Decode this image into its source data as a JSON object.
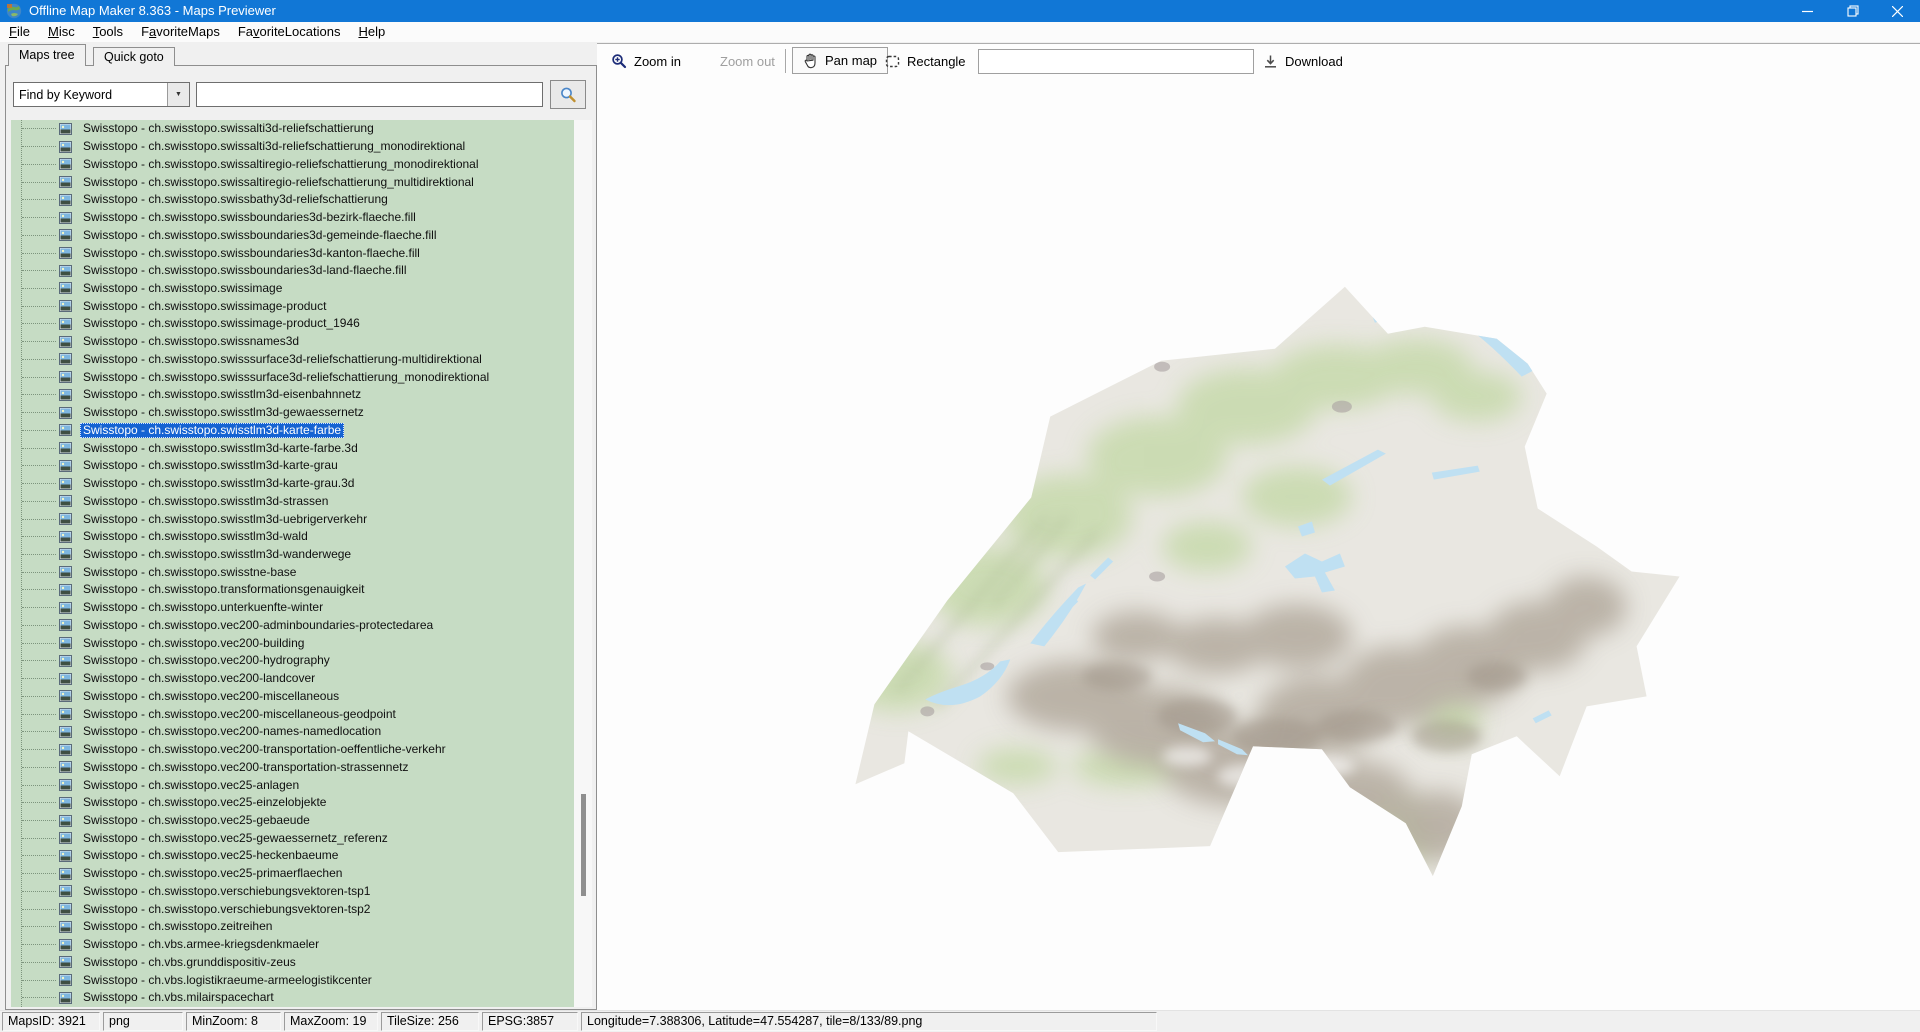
{
  "window": {
    "title": "Offline Map Maker 8.363 - Maps Previewer",
    "controls": [
      "minimize-icon",
      "restore-icon",
      "close-icon"
    ]
  },
  "menubar": {
    "items": [
      {
        "label": "File",
        "accel": 0
      },
      {
        "label": "Misc",
        "accel": 0
      },
      {
        "label": "Tools",
        "accel": 0
      },
      {
        "label": "FavoriteMaps",
        "accel": 1
      },
      {
        "label": "FavoriteLocations",
        "accel": 2
      },
      {
        "label": "Help",
        "accel": 0
      }
    ]
  },
  "tabs": [
    {
      "label": "Maps tree",
      "active": true
    },
    {
      "label": "Quick goto",
      "active": false
    }
  ],
  "search": {
    "mode": "Find by Keyword",
    "query": "",
    "button_icon": "search-icon"
  },
  "maps_tree": {
    "selected_index": 17,
    "items": [
      "Swisstopo - ch.swisstopo.swissalti3d-reliefschattierung",
      "Swisstopo - ch.swisstopo.swissalti3d-reliefschattierung_monodirektional",
      "Swisstopo - ch.swisstopo.swissaltiregio-reliefschattierung_monodirektional",
      "Swisstopo - ch.swisstopo.swissaltiregio-reliefschattierung_multidirektional",
      "Swisstopo - ch.swisstopo.swissbathy3d-reliefschattierung",
      "Swisstopo - ch.swisstopo.swissboundaries3d-bezirk-flaeche.fill",
      "Swisstopo - ch.swisstopo.swissboundaries3d-gemeinde-flaeche.fill",
      "Swisstopo - ch.swisstopo.swissboundaries3d-kanton-flaeche.fill",
      "Swisstopo - ch.swisstopo.swissboundaries3d-land-flaeche.fill",
      "Swisstopo - ch.swisstopo.swissimage",
      "Swisstopo - ch.swisstopo.swissimage-product",
      "Swisstopo - ch.swisstopo.swissimage-product_1946",
      "Swisstopo - ch.swisstopo.swissnames3d",
      "Swisstopo - ch.swisstopo.swisssurface3d-reliefschattierung-multidirektional",
      "Swisstopo - ch.swisstopo.swisssurface3d-reliefschattierung_monodirektional",
      "Swisstopo - ch.swisstopo.swisstlm3d-eisenbahnnetz",
      "Swisstopo - ch.swisstopo.swisstlm3d-gewaessernetz",
      "Swisstopo - ch.swisstopo.swisstlm3d-karte-farbe",
      "Swisstopo - ch.swisstopo.swisstlm3d-karte-farbe.3d",
      "Swisstopo - ch.swisstopo.swisstlm3d-karte-grau",
      "Swisstopo - ch.swisstopo.swisstlm3d-karte-grau.3d",
      "Swisstopo - ch.swisstopo.swisstlm3d-strassen",
      "Swisstopo - ch.swisstopo.swisstlm3d-uebrigerverkehr",
      "Swisstopo - ch.swisstopo.swisstlm3d-wald",
      "Swisstopo - ch.swisstopo.swisstlm3d-wanderwege",
      "Swisstopo - ch.swisstopo.swisstne-base",
      "Swisstopo - ch.swisstopo.transformationsgenauigkeit",
      "Swisstopo - ch.swisstopo.unterkuenfte-winter",
      "Swisstopo - ch.swisstopo.vec200-adminboundaries-protectedarea",
      "Swisstopo - ch.swisstopo.vec200-building",
      "Swisstopo - ch.swisstopo.vec200-hydrography",
      "Swisstopo - ch.swisstopo.vec200-landcover",
      "Swisstopo - ch.swisstopo.vec200-miscellaneous",
      "Swisstopo - ch.swisstopo.vec200-miscellaneous-geodpoint",
      "Swisstopo - ch.swisstopo.vec200-names-namedlocation",
      "Swisstopo - ch.swisstopo.vec200-transportation-oeffentliche-verkehr",
      "Swisstopo - ch.swisstopo.vec200-transportation-strassennetz",
      "Swisstopo - ch.swisstopo.vec25-anlagen",
      "Swisstopo - ch.swisstopo.vec25-einzelobjekte",
      "Swisstopo - ch.swisstopo.vec25-gebaeude",
      "Swisstopo - ch.swisstopo.vec25-gewaessernetz_referenz",
      "Swisstopo - ch.swisstopo.vec25-heckenbaeume",
      "Swisstopo - ch.swisstopo.vec25-primaerflaechen",
      "Swisstopo - ch.swisstopo.verschiebungsvektoren-tsp1",
      "Swisstopo - ch.swisstopo.verschiebungsvektoren-tsp2",
      "Swisstopo - ch.swisstopo.zeitreihen",
      "Swisstopo - ch.vbs.armee-kriegsdenkmaeler",
      "Swisstopo - ch.vbs.grunddispositiv-zeus",
      "Swisstopo - ch.vbs.logistikraeume-armeelogistikcenter",
      "Swisstopo - ch.vbs.milairspacechart"
    ]
  },
  "toolbar": {
    "zoom_in": "Zoom in",
    "zoom_out": "Zoom out",
    "pan_map": "Pan map",
    "rectangle": "Rectangle",
    "download": "Download",
    "input_value": ""
  },
  "statusbar": {
    "maps_id": "MapsID: 3921",
    "format": "png",
    "min_zoom": "MinZoom: 8",
    "max_zoom": "MaxZoom: 19",
    "tile_size": "TileSize: 256",
    "epsg": "EPSG:3857",
    "position": "Longitude=7.388306, Latitude=47.554287, tile=8/133/89.png"
  },
  "colors": {
    "titlebar_bg": "#1177d6",
    "selection_bg": "#1563d2",
    "tree_bg": "#c6dcc4",
    "map_land": "#e9e7e1",
    "map_green": "#c2d8a4",
    "map_mountain": "#b3aa9e",
    "map_lake": "#bfe0f2"
  }
}
